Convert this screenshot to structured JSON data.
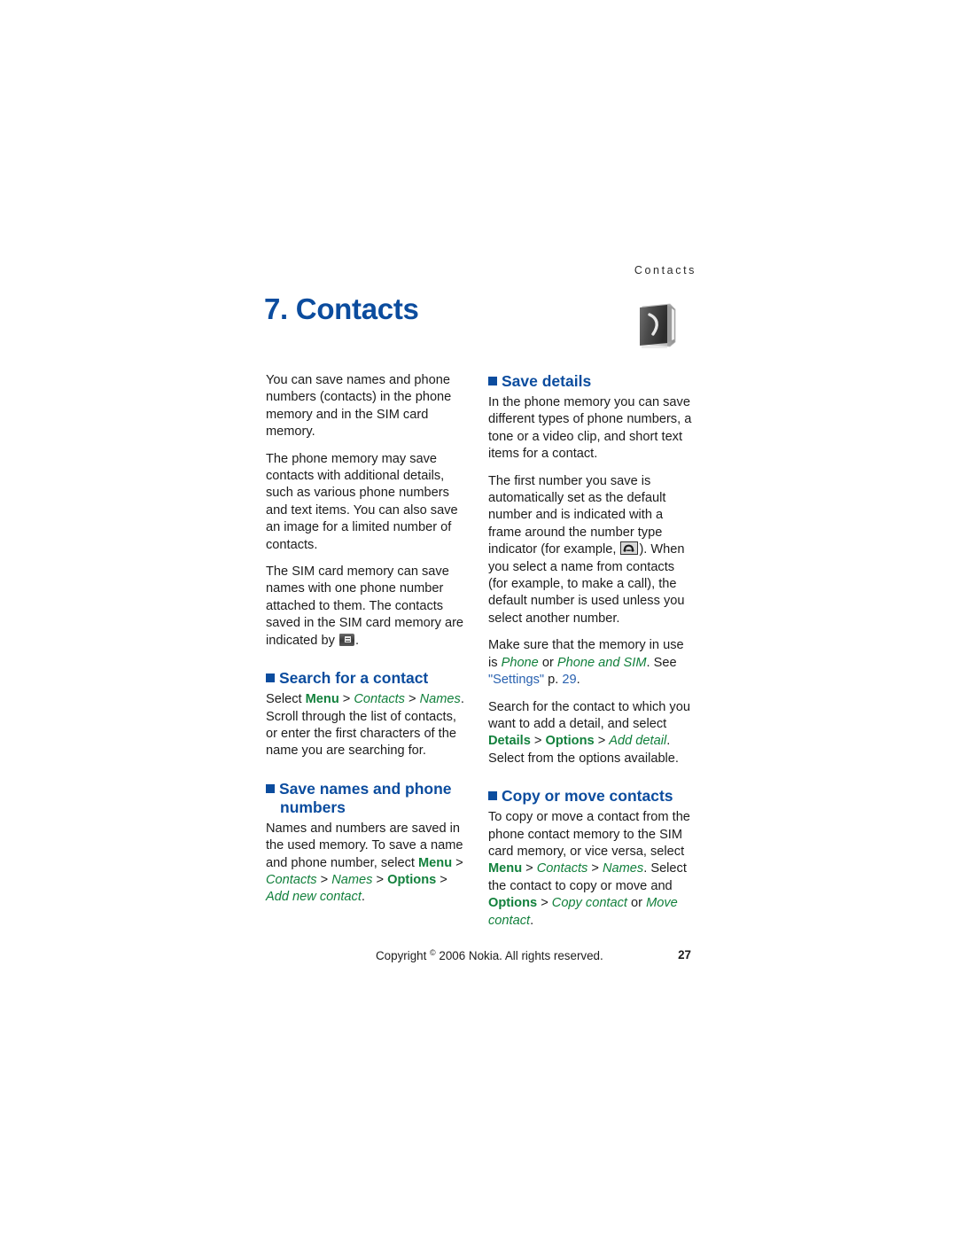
{
  "page": {
    "running_header": "Contacts",
    "chapter_title": "7. Contacts",
    "chapter_icon": "contacts-book-icon",
    "page_number": "27",
    "copyright_prefix": "Copyright ",
    "copyright_symbol": "©",
    "copyright_suffix": " 2006 Nokia. All rights reserved."
  },
  "colors": {
    "heading_blue": "#0b4c9e",
    "menu_green": "#12803c",
    "link_blue": "#2a62b0",
    "body_text": "#1c1c1c"
  },
  "left_column": {
    "intro_paragraphs": [
      "You can save names and phone numbers (contacts) in the phone memory and in the SIM card memory.",
      "The phone memory may save contacts with additional details, such as various phone numbers and text items. You can also save an image for a limited number of contacts."
    ],
    "sim_paragraph": {
      "before_icon": "The SIM card memory can save names with one phone number attached to them. The contacts saved in the SIM card memory are indicated by ",
      "icon": "sim-card-icon",
      "after_icon": "."
    },
    "search_section": {
      "heading": "Search for a contact",
      "select_word": "Select ",
      "path": [
        {
          "text": "Menu",
          "style": "cmd"
        },
        {
          "text": " > ",
          "style": "sep"
        },
        {
          "text": "Contacts",
          "style": "item"
        },
        {
          "text": " > ",
          "style": "sep"
        },
        {
          "text": "Names",
          "style": "item"
        },
        {
          "text": ".",
          "style": "sep"
        }
      ],
      "body": " Scroll through the list of contacts, or enter the first characters of the name you are searching for."
    },
    "save_section": {
      "heading": "Save names and phone numbers",
      "body_lead": "Names and numbers are saved in the used memory. To save a name and phone number, select ",
      "path": [
        {
          "text": "Menu",
          "style": "cmd"
        },
        {
          "text": " > ",
          "style": "sep"
        },
        {
          "text": "Contacts",
          "style": "item"
        },
        {
          "text": " > ",
          "style": "sep"
        },
        {
          "text": "Names",
          "style": "item"
        },
        {
          "text": " > ",
          "style": "sep"
        },
        {
          "text": "Options",
          "style": "cmd"
        },
        {
          "text": " > ",
          "style": "sep"
        },
        {
          "text": "Add new contact",
          "style": "item"
        },
        {
          "text": ".",
          "style": "sep"
        }
      ]
    }
  },
  "right_column": {
    "save_details_section": {
      "heading": "Save details",
      "paragraph_1": "In the phone memory you can save different types of phone numbers, a tone or a video clip, and short text items for a contact.",
      "paragraph_2_before_icon": "The first number you save is automatically set as the default number and is indicated with a frame around the number type indicator (for example, ",
      "paragraph_2_icon": "phone-number-type-icon",
      "paragraph_2_after_icon": "). When you select a name from contacts (for example, to make a call), the default number is used unless you select another number.",
      "memory_lead": "Make sure that the memory in use is ",
      "memory_path": [
        {
          "text": "Phone",
          "style": "item"
        },
        {
          "text": " or ",
          "style": "sep"
        },
        {
          "text": "Phone and SIM",
          "style": "item"
        },
        {
          "text": ". See ",
          "style": "sep"
        },
        {
          "text": "\"Settings\"",
          "style": "link"
        },
        {
          "text": " p. ",
          "style": "sep"
        },
        {
          "text": "29",
          "style": "link"
        },
        {
          "text": ".",
          "style": "sep"
        }
      ],
      "add_detail_lead": "Search for the contact to which you want to add a detail, and select ",
      "add_detail_path": [
        {
          "text": "Details",
          "style": "cmd"
        },
        {
          "text": " > ",
          "style": "sep"
        },
        {
          "text": "Options",
          "style": "cmd"
        },
        {
          "text": " > ",
          "style": "sep"
        },
        {
          "text": "Add detail",
          "style": "item"
        },
        {
          "text": ".",
          "style": "sep"
        }
      ],
      "add_detail_tail": " Select from the options available."
    },
    "copy_move_section": {
      "heading": "Copy or move contacts",
      "body_lead": "To copy or move a contact from the phone contact memory to the SIM card memory, or vice versa, select ",
      "path_1": [
        {
          "text": "Menu",
          "style": "cmd"
        },
        {
          "text": " > ",
          "style": "sep"
        },
        {
          "text": "Contacts",
          "style": "item"
        },
        {
          "text": " > ",
          "style": "sep"
        },
        {
          "text": "Names",
          "style": "item"
        },
        {
          "text": ".",
          "style": "sep"
        }
      ],
      "middle": " Select the contact to copy or move and ",
      "path_2": [
        {
          "text": "Options",
          "style": "cmd"
        },
        {
          "text": " > ",
          "style": "sep"
        },
        {
          "text": "Copy contact",
          "style": "item"
        },
        {
          "text": " or ",
          "style": "sep"
        },
        {
          "text": "Move contact",
          "style": "item"
        },
        {
          "text": ".",
          "style": "sep"
        }
      ]
    }
  }
}
